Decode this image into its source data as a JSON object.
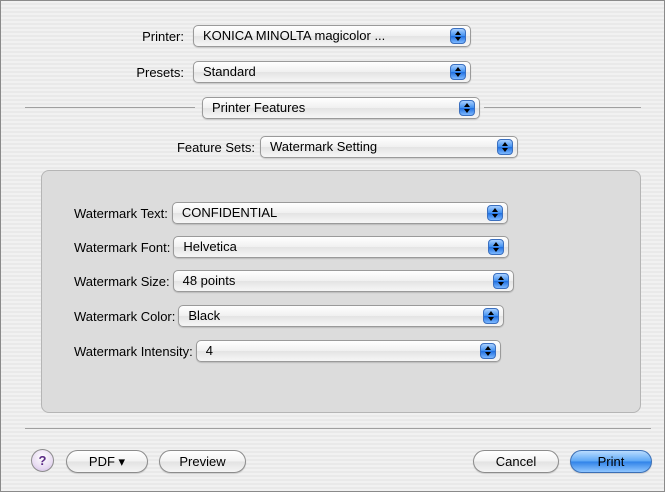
{
  "printer": {
    "label": "Printer:",
    "value": "KONICA MINOLTA magicolor ..."
  },
  "presets": {
    "label": "Presets:",
    "value": "Standard"
  },
  "panel": {
    "value": "Printer Features"
  },
  "feature_sets": {
    "label": "Feature Sets:",
    "value": "Watermark Setting"
  },
  "watermark": {
    "text": {
      "label": "Watermark Text:",
      "value": "CONFIDENTIAL"
    },
    "font": {
      "label": "Watermark Font:",
      "value": "Helvetica"
    },
    "size": {
      "label": "Watermark Size:",
      "value": "48 points"
    },
    "color": {
      "label": "Watermark Color:",
      "value": "Black"
    },
    "intensity": {
      "label": "Watermark Intensity:",
      "value": "4"
    }
  },
  "footer": {
    "help": "?",
    "pdf": "PDF ▾",
    "preview": "Preview",
    "cancel": "Cancel",
    "print": "Print"
  },
  "icons": {
    "popup": "up-down-arrows-icon",
    "help": "help-icon"
  }
}
